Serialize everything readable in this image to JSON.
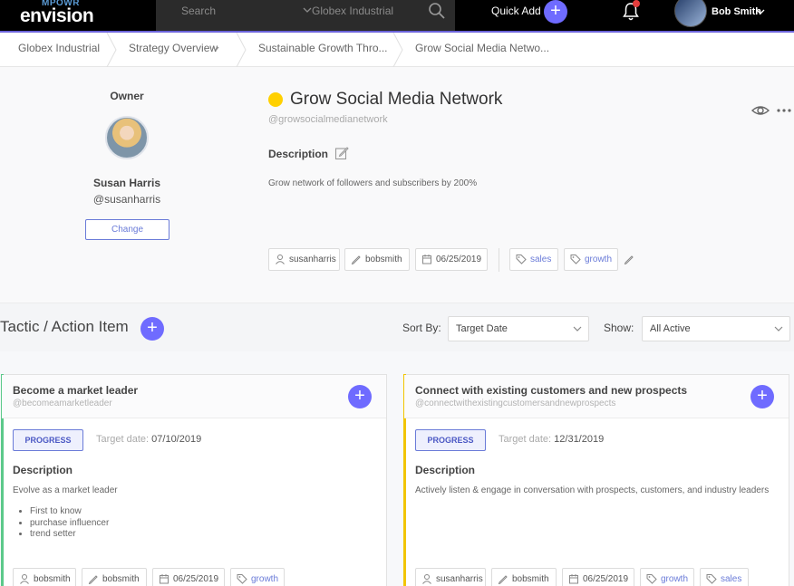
{
  "nav": {
    "logo_top": "MPOWR",
    "logo_main": "envision",
    "search_placeholder": "Search",
    "org": "Globex Industrial",
    "quick_add": "Quick Add",
    "user_name": "Bob Smith"
  },
  "breadcrumbs": [
    "Globex Industrial",
    "Strategy Overview",
    "Sustainable Growth Thro...",
    "Grow Social Media Netwo..."
  ],
  "owner": {
    "label": "Owner",
    "name": "Susan Harris",
    "handle": "@susanharris",
    "change_label": "Change"
  },
  "goal": {
    "status_color": "#ffd000",
    "title": "Grow Social Media Network",
    "handle": "@growsocialmedianetwork",
    "description_label": "Description",
    "description": "Grow network of followers and subscribers by 200%",
    "chips": {
      "owner": "susanharris",
      "editor": "bobsmith",
      "date": "06/25/2019",
      "tag1": "sales",
      "tag2": "growth"
    }
  },
  "tactics": {
    "title": "Tactic / Action Item",
    "sort_label": "Sort By:",
    "sort_value": "Target Date",
    "show_label": "Show:",
    "show_value": "All Active"
  },
  "cards": [
    {
      "accent": "#5cc98a",
      "title": "Become a market leader",
      "handle": "@becomeamarketleader",
      "status": "PROGRESS",
      "target_label": "Target date:",
      "target_date": "07/10/2019",
      "description_label": "Description",
      "description": "Evolve as a market leader",
      "bullets": [
        "First to know",
        "purchase influencer",
        "trend setter"
      ],
      "chips": {
        "owner": "bobsmith",
        "editor": "bobsmith",
        "date": "06/25/2019",
        "tag1": "growth"
      }
    },
    {
      "accent": "#f2c500",
      "title": "Connect with existing customers and new prospects",
      "handle": "@connectwithexistingcustomersandnewprospects",
      "status": "PROGRESS",
      "target_label": "Target date:",
      "target_date": "12/31/2019",
      "description_label": "Description",
      "description": "Actively listen & engage in conversation with prospects, customers, and industry leaders",
      "chips": {
        "owner": "susanharris",
        "editor": "bobsmith",
        "date": "06/25/2019",
        "tag1": "growth",
        "tag2": "sales"
      }
    }
  ]
}
